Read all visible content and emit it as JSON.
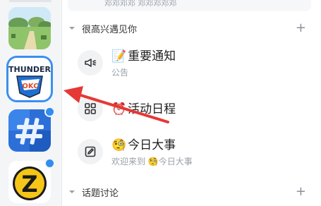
{
  "top_strip": {
    "text": "邓邓邓邓 邓邓邓邓邓"
  },
  "sections": [
    {
      "title": "很高兴遇见你",
      "add_label": "+"
    },
    {
      "title": "话题讨论",
      "add_label": "+"
    }
  ],
  "channels": [
    {
      "emoji": "📝",
      "name": "重要通知",
      "subtitle": "公告",
      "icon": "megaphone-icon"
    },
    {
      "emoji": "⏰",
      "name": "活动日程",
      "subtitle": "",
      "icon": "grid-icon"
    },
    {
      "emoji": "🧐",
      "name": "今日大事",
      "subtitle": "欢迎来到 🧐今日大事",
      "icon": "edit-icon"
    }
  ],
  "servers": [
    {
      "name": "landscape-server",
      "has_badge": false
    },
    {
      "name": "thunder-server",
      "label": "THUNDER",
      "sub_label": "OKC",
      "selected": true
    },
    {
      "name": "hash-server",
      "has_badge": true
    },
    {
      "name": "z-server",
      "label": "Z",
      "has_badge": true
    }
  ],
  "colors": {
    "selected_ring": "#3a8ff0",
    "badge": "#2f8ef0",
    "arrow": "#e53935"
  }
}
